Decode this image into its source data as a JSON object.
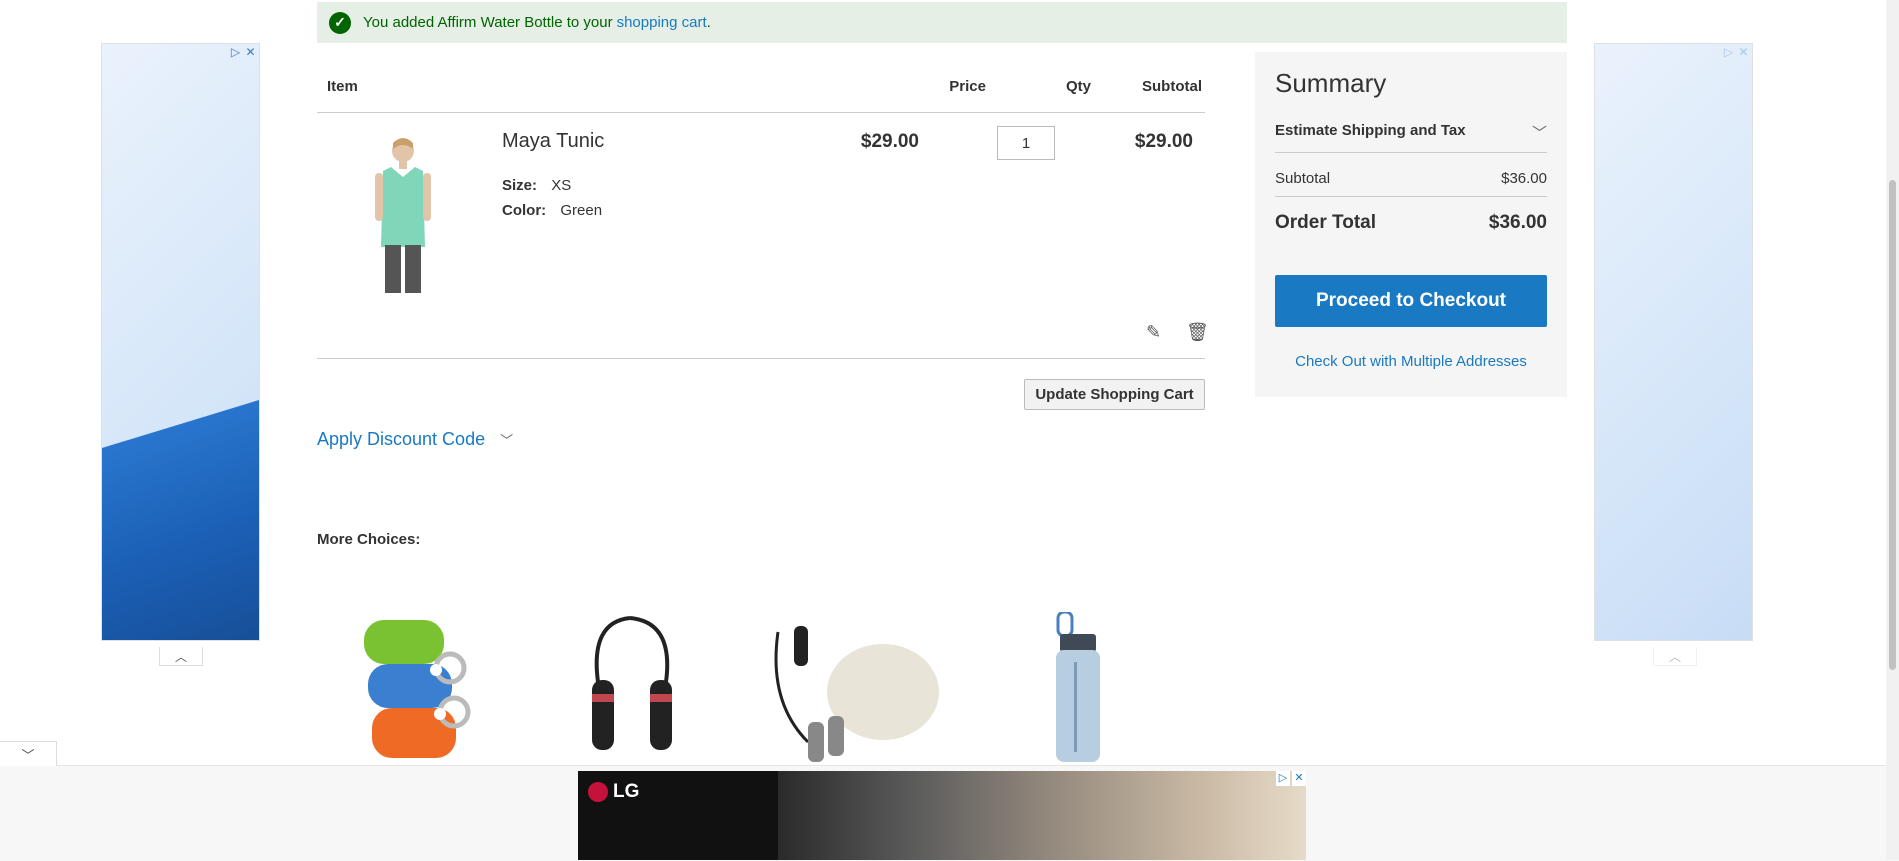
{
  "message": {
    "text": "You added Affirm Water Bottle to your",
    "link": "shopping cart",
    "end": "."
  },
  "cart": {
    "headers": {
      "item": "Item",
      "price": "Price",
      "qty": "Qty",
      "subtotal": "Subtotal"
    },
    "items": [
      {
        "name": "Maya Tunic",
        "options": [
          {
            "label": "Size:",
            "value": "XS"
          },
          {
            "label": "Color:",
            "value": "Green"
          }
        ],
        "price": "$29.00",
        "qty": "1",
        "subtotal": "$29.00"
      }
    ],
    "update_label": "Update Shopping Cart",
    "discount_label": "Apply Discount Code"
  },
  "more_choices": {
    "title": "More Choices:",
    "products": [
      "yoga-straps",
      "jump-rope",
      "jump-rope-kit",
      "water-bottle"
    ]
  },
  "summary": {
    "title": "Summary",
    "estimate_label": "Estimate Shipping and Tax",
    "subtotal_label": "Subtotal",
    "subtotal_value": "$36.00",
    "total_label": "Order Total",
    "total_value": "$36.00",
    "checkout_label": "Proceed to Checkout",
    "multi_label": "Check Out with Multiple Addresses"
  },
  "ads": {
    "bottom_brand": "LG"
  },
  "colors": {
    "accent": "#1979c3",
    "success_bg": "#e5efe5",
    "success_text": "#006400"
  }
}
